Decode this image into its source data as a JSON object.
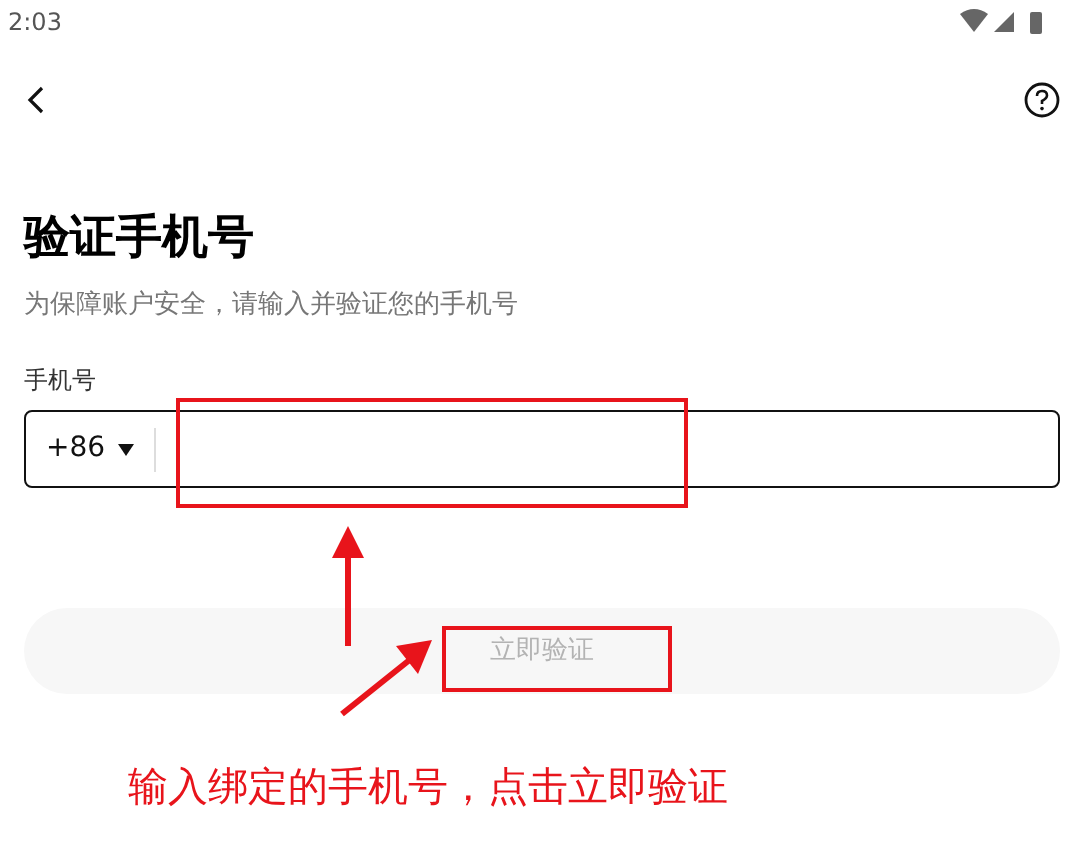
{
  "status_bar": {
    "time": "2:03"
  },
  "page": {
    "title": "验证手机号",
    "subtitle": "为保障账户安全，请输入并验证您的手机号"
  },
  "phone_field": {
    "label": "手机号",
    "country_code": "+86"
  },
  "verify_button": {
    "label": "立即验证",
    "disabled": true
  },
  "annotation": {
    "text": "输入绑定的手机号，点击立即验证"
  }
}
